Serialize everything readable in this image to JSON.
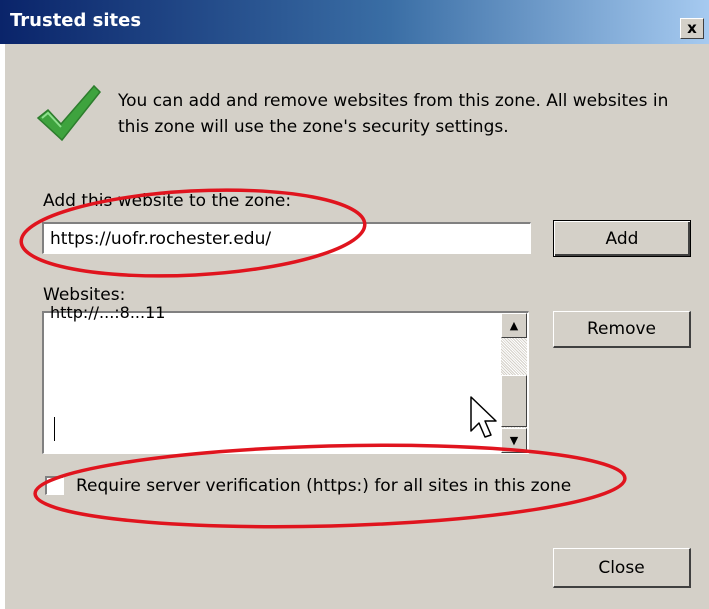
{
  "dialog": {
    "title": "Trusted sites",
    "close_glyph": "x",
    "info_text": "You can add and remove websites from this zone. All websites in this zone will use the zone's security settings.",
    "add_label": "Add this website to the zone:",
    "url_value": "https://uofr.rochester.edu/",
    "add_button": "Add",
    "websites_label": "Websites:",
    "websites_list_partial_item": "http://...:8...11",
    "remove_button": "Remove",
    "verify_label": "Require server verification (https:) for all sites in this zone",
    "verify_checked": false,
    "close_button": "Close"
  },
  "icons": {
    "status": "checkmark-icon",
    "pointer": "mouse-cursor-icon",
    "scroll_up": "scroll-up-arrow-icon",
    "scroll_down": "scroll-down-arrow-icon"
  },
  "colors": {
    "titlebar_start": "#0a246a",
    "titlebar_end": "#a6caf0",
    "dialog_bg": "#d4d0c8",
    "check_green": "#3ea33e",
    "annotation_red": "#e0141e"
  }
}
